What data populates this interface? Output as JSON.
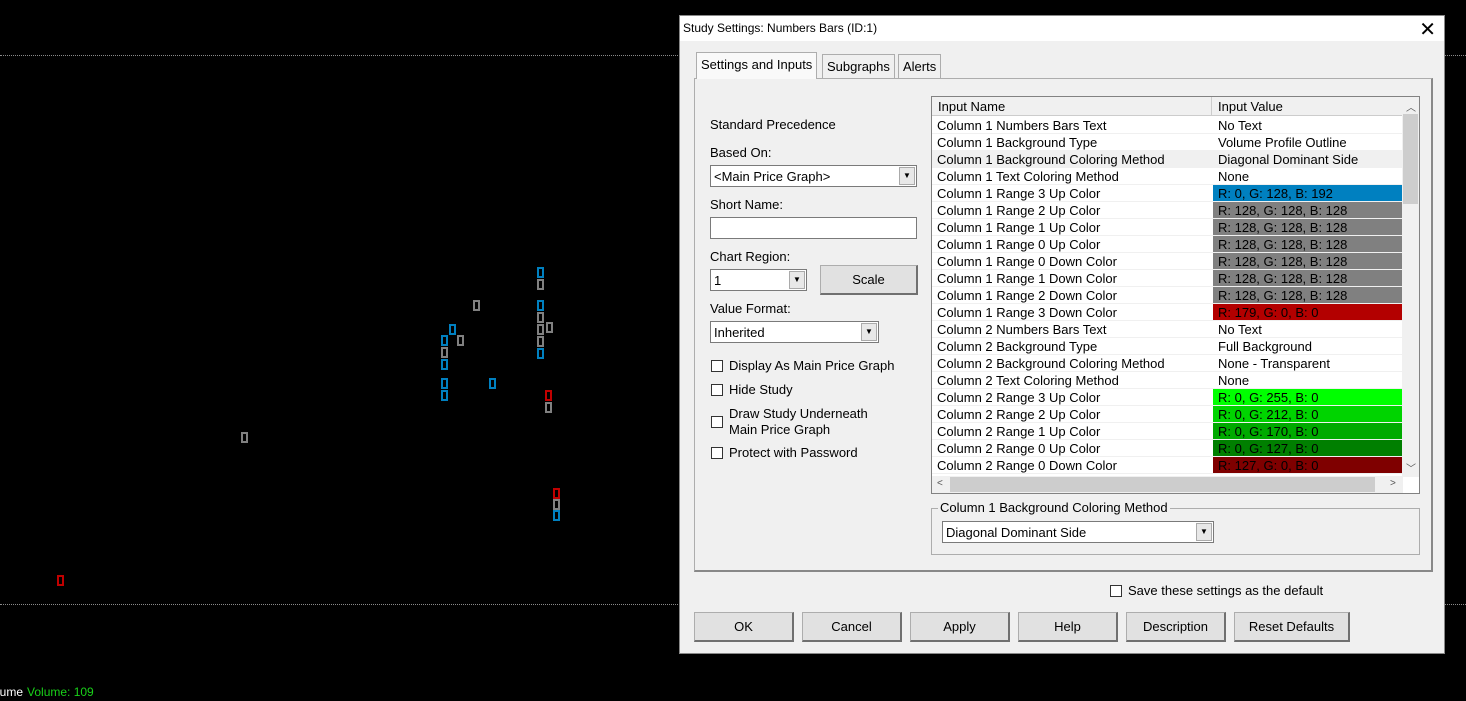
{
  "chart": {
    "status_label": "lume",
    "volume_text": "Volume: 109",
    "colors": {
      "blue": "#0080c0",
      "gray": "#808080",
      "red": "#c00000"
    }
  },
  "dialog": {
    "title": "Study Settings: Numbers Bars (ID:1)",
    "close_icon": "close-icon",
    "tabs": [
      {
        "label": "Settings and Inputs",
        "active": true
      },
      {
        "label": "Subgraphs",
        "active": false
      },
      {
        "label": "Alerts",
        "active": false
      }
    ],
    "left": {
      "standard_precedence": "Standard Precedence",
      "based_on_label": "Based On:",
      "based_on_value": "<Main Price Graph>",
      "short_name_label": "Short Name:",
      "short_name_value": "",
      "chart_region_label": "Chart Region:",
      "chart_region_value": "1",
      "scale_button": "Scale",
      "value_format_label": "Value Format:",
      "value_format_value": "Inherited",
      "checkboxes": [
        {
          "label": "Display As Main Price Graph",
          "checked": false
        },
        {
          "label": "Hide Study",
          "checked": false
        },
        {
          "label": "Draw Study Underneath",
          "label2": "Main Price Graph",
          "checked": false
        },
        {
          "label": "Protect with Password",
          "checked": false
        }
      ]
    },
    "grid": {
      "headers": [
        "Input Name",
        "Input Value"
      ],
      "rows": [
        {
          "name": "Column 1 Numbers Bars Text",
          "value": "No Text"
        },
        {
          "name": "Column 1 Background Type",
          "value": "Volume Profile Outline"
        },
        {
          "name": "Column 1 Background Coloring Method",
          "value": "Diagonal Dominant Side",
          "selected": true
        },
        {
          "name": "Column 1 Text Coloring Method",
          "value": "None"
        },
        {
          "name": "Column 1 Range 3 Up Color",
          "value": "R: 0, G: 128, B: 192",
          "color": "#0080c0"
        },
        {
          "name": "Column 1 Range 2 Up Color",
          "value": "R: 128, G: 128, B: 128",
          "color": "#808080"
        },
        {
          "name": "Column 1 Range 1 Up Color",
          "value": "R: 128, G: 128, B: 128",
          "color": "#808080"
        },
        {
          "name": "Column 1 Range 0 Up Color",
          "value": "R: 128, G: 128, B: 128",
          "color": "#808080"
        },
        {
          "name": "Column 1 Range 0 Down Color",
          "value": "R: 128, G: 128, B: 128",
          "color": "#808080"
        },
        {
          "name": "Column 1 Range 1 Down Color",
          "value": "R: 128, G: 128, B: 128",
          "color": "#808080"
        },
        {
          "name": "Column 1 Range 2 Down Color",
          "value": "R: 128, G: 128, B: 128",
          "color": "#808080"
        },
        {
          "name": "Column 1 Range 3 Down Color",
          "value": "R: 179, G: 0, B: 0",
          "color": "#b30000"
        },
        {
          "name": "Column 2 Numbers Bars Text",
          "value": "No Text"
        },
        {
          "name": "Column 2 Background Type",
          "value": "Full Background"
        },
        {
          "name": "Column 2 Background Coloring Method",
          "value": "None - Transparent"
        },
        {
          "name": "Column 2 Text Coloring Method",
          "value": "None"
        },
        {
          "name": "Column 2 Range 3 Up Color",
          "value": "R: 0, G: 255, B: 0",
          "color": "#00ff00"
        },
        {
          "name": "Column 2 Range 2 Up Color",
          "value": "R: 0, G: 212, B: 0",
          "color": "#00d400"
        },
        {
          "name": "Column 2 Range 1 Up Color",
          "value": "R: 0, G: 170, B: 0",
          "color": "#00aa00"
        },
        {
          "name": "Column 2 Range 0 Up Color",
          "value": "R: 0, G: 127, B: 0",
          "color": "#007f00"
        },
        {
          "name": "Column 2 Range 0 Down Color",
          "value": "R: 127, G: 0, B: 0",
          "color": "#7f0000"
        }
      ]
    },
    "selected_input": {
      "group_label": "Column 1 Background Coloring Method",
      "value": "Diagonal Dominant Side"
    },
    "save_default_label": "Save these settings as the default",
    "buttons": {
      "ok": "OK",
      "cancel": "Cancel",
      "apply": "Apply",
      "help": "Help",
      "description": "Description",
      "reset": "Reset Defaults"
    }
  }
}
